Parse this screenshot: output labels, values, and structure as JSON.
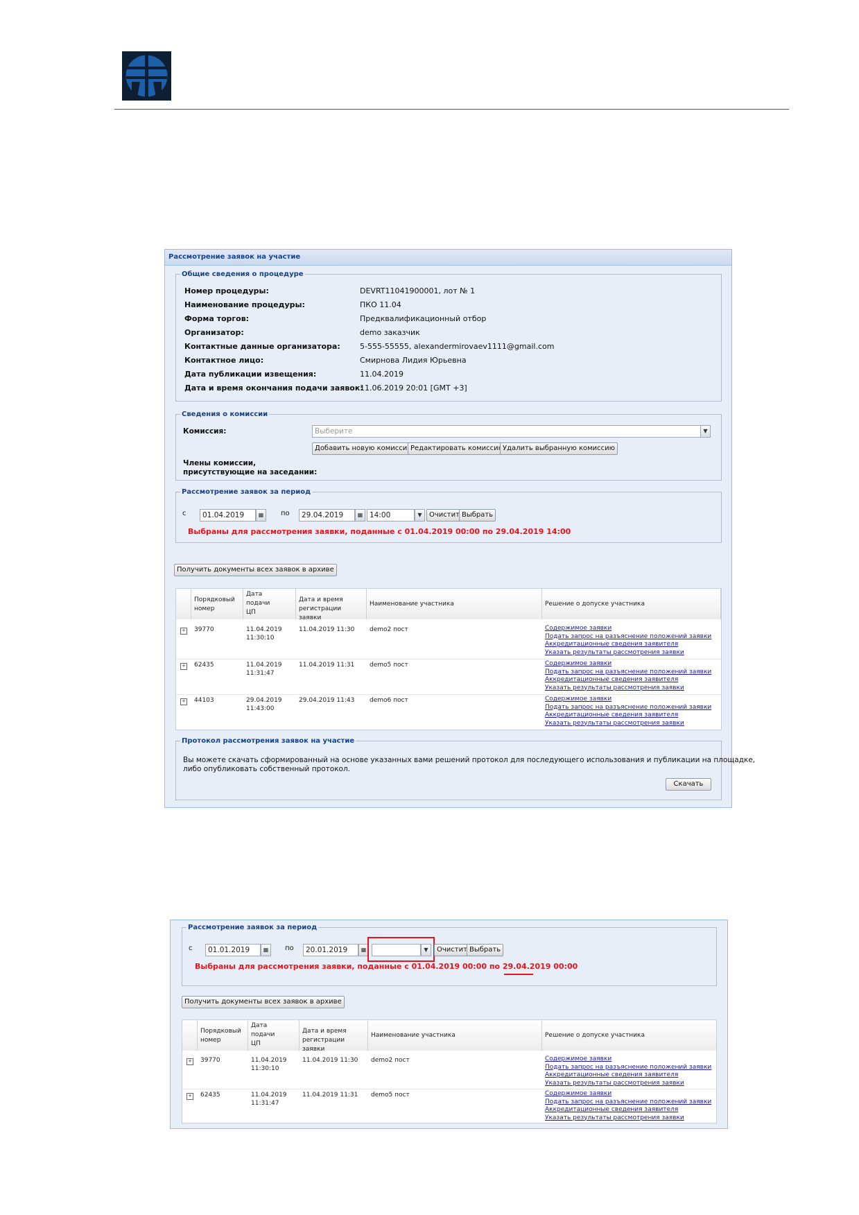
{
  "procedure_card": {
    "title": "Рассмотрение заявок на участие",
    "general_legend": "Общие сведения о процедуре",
    "fields": [
      {
        "label": "Номер процедуры:",
        "value": "DEVRT11041900001, лот № 1"
      },
      {
        "label": "Наименование процедуры:",
        "value": "ПКО 11.04"
      },
      {
        "label": "Форма торгов:",
        "value": "Предквалификационный отбор"
      },
      {
        "label": "Организатор:",
        "value": "demo заказчик"
      },
      {
        "label": "Контактные данные организатора:",
        "value": "5-555-55555, alexandermirovaev1111@gmail.com"
      },
      {
        "label": "Контактное лицо:",
        "value": "Смирнова Лидия Юрьевна"
      },
      {
        "label": "Дата публикации извещения:",
        "value": "11.04.2019"
      },
      {
        "label": "Дата и время окончания подачи заявок:",
        "value": "11.06.2019 20:01 [GMT +3]"
      }
    ],
    "commission": {
      "legend": "Сведения о комиссии",
      "label": "Комиссия:",
      "select_placeholder": "Выберите",
      "add_button": "Добавить новую комиссию",
      "edit_button": "Редактировать комиссию",
      "delete_button": "Удалить выбранную комиссию",
      "members_label_1": "Члены комиссии,",
      "members_label_2": "присутствующие на заседании:"
    },
    "period": {
      "legend": "Рассмотрение заявок за период",
      "from_label": "с",
      "from_value": "01.04.2019",
      "to_label": "по",
      "to_value": "29.04.2019",
      "time_value": "14:00",
      "clear_button": "Очистить",
      "select_button": "Выбрать",
      "message": "Выбраны для рассмотрения заявки, поданные с 01.04.2019 00:00 по 29.04.2019 14:00"
    },
    "archive_button": "Получить документы всех заявок в архиве",
    "columns": {
      "num_1": "Порядковый",
      "num_2": "номер",
      "date_1": "Дата",
      "date_2": "подачи",
      "date_3": "ЦП",
      "reg_1": "Дата и время",
      "reg_2": "регистрации заявки",
      "name": "Наименование участника",
      "decision": "Решение о допуске участника"
    },
    "rows": [
      {
        "num": "39770",
        "d1": "11.04.2019",
        "d2": "11:30:10",
        "reg": "11.04.2019 11:30",
        "name": "demo2 пост"
      },
      {
        "num": "62435",
        "d1": "11.04.2019",
        "d2": "11:31:47",
        "reg": "11.04.2019 11:31",
        "name": "demo5 пост"
      },
      {
        "num": "44103",
        "d1": "29.04.2019",
        "d2": "11:43:00",
        "reg": "29.04.2019 11:43",
        "name": "demo6 пост"
      }
    ],
    "links": {
      "content": "Содержимое заявки",
      "request": "Подать запрос на разъяснение положений заявки",
      "accreditation": "Аккредитационные сведения заявителя",
      "result": "Указать результаты рассмотрения заявки"
    },
    "protocol": {
      "legend": "Протокол рассмотрения заявок на участие",
      "text_1": "Вы можете скачать сформированный на основе указанных вами решений протокол для последующего использования и публикации на площадке,",
      "text_2": "либо опубликовать собственный протокол.",
      "download_button": "Скачать"
    }
  },
  "period_card": {
    "legend": "Рассмотрение заявок за период",
    "from_label": "с",
    "from_value": "01.01.2019",
    "to_label": "по",
    "to_value": "20.01.2019",
    "time_value": "",
    "clear_button": "Очистить",
    "select_button": "Выбрать",
    "message_part1": "Выбраны для рассмотрения заявки, поданные с 01.04.2019 00:00 по 29.04.2019 ",
    "message_part2": "00:00",
    "archive_button": "Получить документы всех заявок в архиве",
    "rows": [
      {
        "num": "39770",
        "d1": "11.04.2019",
        "d2": "11:30:10",
        "reg": "11.04.2019 11:30",
        "name": "demo2 пост"
      },
      {
        "num": "62435",
        "d1": "11.04.2019",
        "d2": "11:31:47",
        "reg": "11.04.2019 11:31",
        "name": "demo5 пост"
      }
    ]
  },
  "colors": {
    "accent": "#15428b",
    "alert": "#e8141c",
    "link": "#1a1aa6",
    "logo": "#1d5fa8"
  }
}
